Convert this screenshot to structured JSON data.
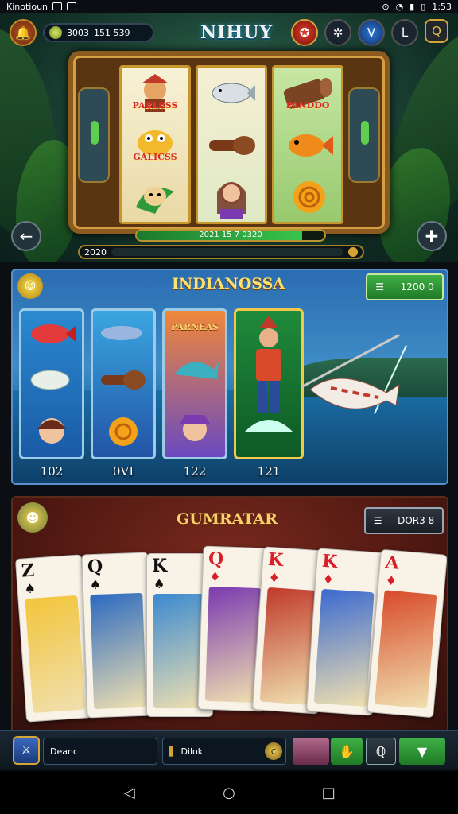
{
  "status_bar": {
    "left_text": "Kinotioun",
    "right_text": "1:53"
  },
  "header": {
    "title": "NIHUY",
    "coins_label": "3003",
    "coins_value": "151 539"
  },
  "slot": {
    "reel1_labels": [
      "PARLESS",
      "GALICSS",
      ""
    ],
    "reel2_labels": [
      "",
      "",
      ""
    ],
    "reel3_labels": [
      "",
      "PANDDO",
      ""
    ],
    "progress_text": "2021 15 7 0320",
    "progress_value": 0.88,
    "balance_text": "2020"
  },
  "fishing": {
    "title": "INDIANOSSA",
    "button_value": "1200 0",
    "card_numbers": [
      "102",
      "0VI",
      "122",
      "121"
    ],
    "card3_label": "PARNEAS"
  },
  "cards_section": {
    "title": "GUMRATAR",
    "button_value": "DOR3 8",
    "cards": [
      {
        "rank": "Z",
        "suit": "♠",
        "color": "black"
      },
      {
        "rank": "Q",
        "suit": "♠",
        "color": "black"
      },
      {
        "rank": "K",
        "suit": "♠",
        "color": "black"
      },
      {
        "rank": "Q",
        "suit": "♦",
        "color": "red"
      },
      {
        "rank": "K",
        "suit": "♦",
        "color": "red"
      },
      {
        "rank": "K",
        "suit": "♦",
        "color": "red"
      },
      {
        "rank": "A",
        "suit": "♦",
        "color": "red"
      }
    ]
  },
  "bottom_bar": {
    "field1": "Deanc",
    "field2": "Dilok"
  },
  "colors": {
    "accent_green": "#3fb046",
    "accent_gold": "#d4a535",
    "title_yellow": "#ffe06b"
  }
}
